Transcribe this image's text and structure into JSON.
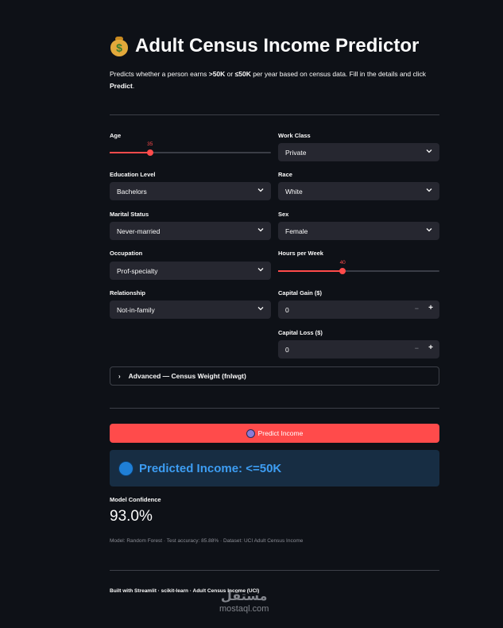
{
  "header": {
    "emoji": "$",
    "title": "Adult Census Income Predictor",
    "subtitle_pre": "Predicts whether a person earns ",
    "subtitle_b1": ">50K",
    "subtitle_mid": " or ",
    "subtitle_b2": "≤50K",
    "subtitle_post": " per year based on census data. Fill in the details and click ",
    "subtitle_b3": "Predict",
    "subtitle_end": "."
  },
  "form": {
    "age": {
      "label": "Age",
      "value": "35",
      "fraction": 0.25
    },
    "workclass": {
      "label": "Work Class",
      "value": "Private"
    },
    "education": {
      "label": "Education Level",
      "value": "Bachelors"
    },
    "race": {
      "label": "Race",
      "value": "White"
    },
    "marital": {
      "label": "Marital Status",
      "value": "Never-married"
    },
    "sex": {
      "label": "Sex",
      "value": "Female"
    },
    "occupation": {
      "label": "Occupation",
      "value": "Prof-specialty"
    },
    "hours": {
      "label": "Hours per Week",
      "value": "40",
      "fraction": 0.4
    },
    "relationship": {
      "label": "Relationship",
      "value": "Not-in-family"
    },
    "capital_gain": {
      "label": "Capital Gain ($)",
      "value": "0",
      "minus": "−",
      "plus": "+"
    },
    "capital_loss": {
      "label": "Capital Loss ($)",
      "value": "0",
      "minus": "−",
      "plus": "+"
    }
  },
  "advanced": {
    "label": "Advanced — Census Weight (fnlwgt)"
  },
  "predict": {
    "label": "Predict Income"
  },
  "result": {
    "text": "Predicted Income: <=50K"
  },
  "metric": {
    "label": "Model Confidence",
    "value": "93.0%"
  },
  "caption": "Model: Random Forest · Test accuracy: 85.88% · Dataset: UCI Adult Census Income",
  "footer": "Built with Streamlit · scikit-learn · Adult Census Income (UCI)",
  "watermark": {
    "arabic": "مستقل",
    "latin": "mostaql.com"
  },
  "colors": {
    "accent": "#ff4b4b",
    "background": "#0e1117",
    "input": "#262730",
    "info_bg": "#172d43",
    "info_text": "#3d9df3"
  }
}
